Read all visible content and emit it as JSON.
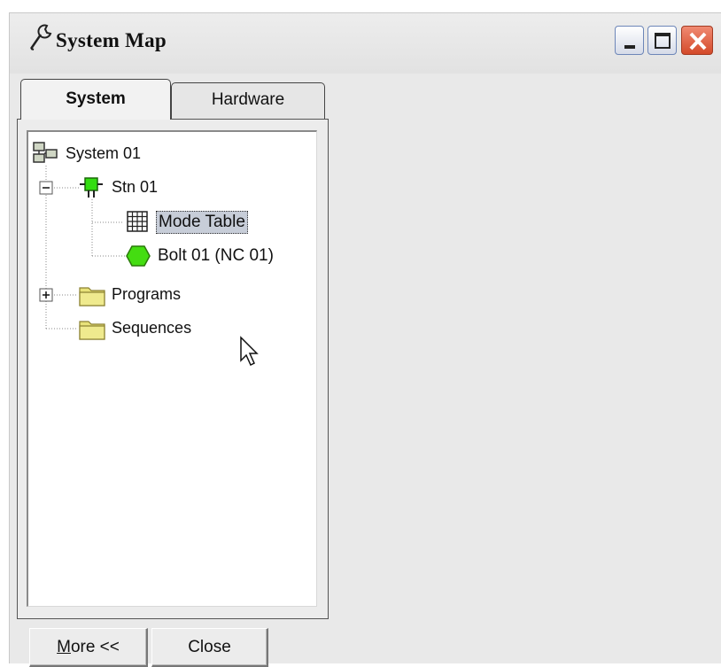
{
  "window": {
    "title": "System Map",
    "title_icon": "wrench-icon",
    "controls": {
      "minimize": "minimize-icon",
      "maximize": "maximize-icon",
      "close": "close-icon"
    }
  },
  "tabs": [
    {
      "label": "System",
      "active": true
    },
    {
      "label": "Hardware",
      "active": false
    }
  ],
  "tree": [
    {
      "label": "System 01",
      "icon": "network-icon",
      "level": 0
    },
    {
      "label": "Stn 01",
      "icon": "station-icon",
      "level": 1,
      "expanded": true,
      "icon_color": "#33dd11"
    },
    {
      "label": "Mode Table",
      "icon": "table-grid-icon",
      "level": 2,
      "selected": true
    },
    {
      "label": "Bolt 01 (NC 01)",
      "icon": "bolt-hexagon-icon",
      "level": 2,
      "icon_color": "#44dd11"
    },
    {
      "label": "Programs",
      "icon": "folder-icon",
      "level": 1,
      "expanded": false,
      "icon_color": "#e8e27a"
    },
    {
      "label": "Sequences",
      "icon": "folder-icon",
      "level": 1,
      "icon_color": "#e8e27a"
    }
  ],
  "buttons": {
    "more_accel": "M",
    "more_rest": "ore <<",
    "close": "Close"
  },
  "cursor": "pointer-arrow-icon"
}
